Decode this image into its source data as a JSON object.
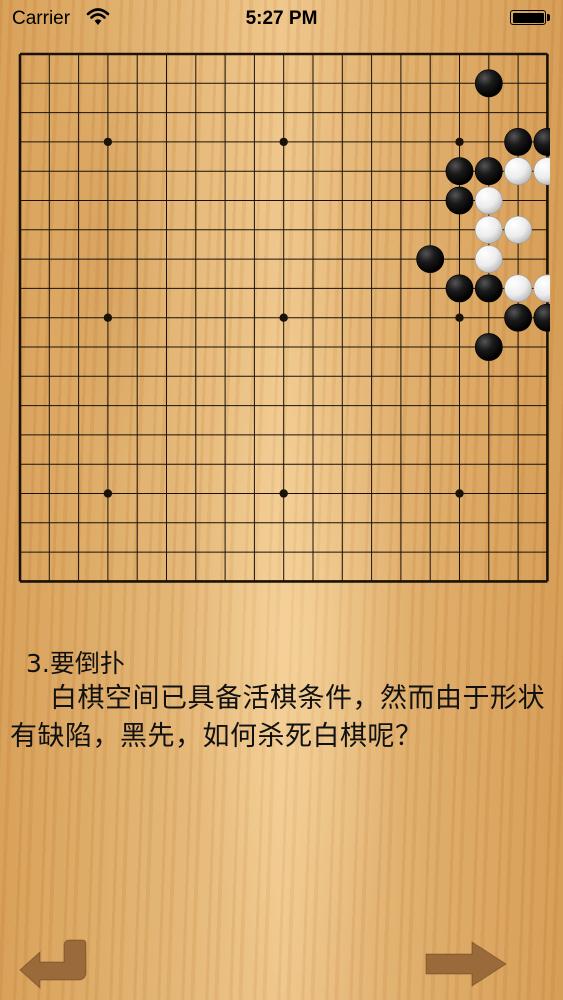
{
  "status_bar": {
    "carrier": "Carrier",
    "time": "5:27 PM",
    "battery_level": 1.0
  },
  "board": {
    "size": 19,
    "star_points": [
      [
        3,
        3
      ],
      [
        3,
        9
      ],
      [
        3,
        15
      ],
      [
        9,
        3
      ],
      [
        9,
        9
      ],
      [
        9,
        15
      ],
      [
        15,
        3
      ],
      [
        15,
        9
      ],
      [
        15,
        15
      ]
    ],
    "black_stones": [
      [
        1,
        16
      ],
      [
        3,
        17
      ],
      [
        3,
        18
      ],
      [
        4,
        15
      ],
      [
        4,
        16
      ],
      [
        5,
        15
      ],
      [
        7,
        14
      ],
      [
        8,
        15
      ],
      [
        8,
        16
      ],
      [
        9,
        17
      ],
      [
        9,
        18
      ],
      [
        10,
        16
      ]
    ],
    "white_stones": [
      [
        4,
        17
      ],
      [
        4,
        18
      ],
      [
        5,
        16
      ],
      [
        6,
        16
      ],
      [
        6,
        17
      ],
      [
        7,
        16
      ],
      [
        8,
        17
      ],
      [
        8,
        18
      ]
    ],
    "colors": {
      "line": "#1a1208",
      "black_stone": "#111111",
      "white_stone": "#f2f2f2"
    }
  },
  "problem": {
    "title": "3.要倒扑",
    "description": "白棋空间已具备活棋条件，然而由于形状有缺陷，黑先，如何杀死白棋呢？"
  },
  "navigation": {
    "back_icon": "back-arrow-icon",
    "next_icon": "next-arrow-icon",
    "arrow_color": "#9a6a3a"
  }
}
